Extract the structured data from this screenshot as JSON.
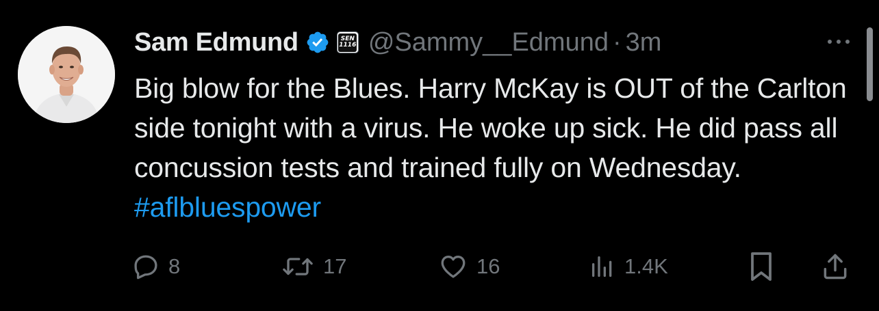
{
  "tweet": {
    "author": {
      "display_name": "Sam Edmund",
      "handle": "@Sammy__Edmund",
      "verified": true,
      "affiliate_badge": {
        "line1": "SEN",
        "line2": "1116"
      }
    },
    "separator": "·",
    "timestamp": "3m",
    "text_main": "Big blow for the Blues. Harry McKay is OUT of the Carlton side tonight with a virus. He woke up sick. He did pass all concussion tests and trained fully on Wednesday.",
    "hashtag": "#aflbluespower",
    "actions": {
      "reply_count": "8",
      "retweet_count": "17",
      "like_count": "16",
      "views_count": "1.4K"
    }
  },
  "colors": {
    "background": "#000000",
    "text": "#e7e9ea",
    "muted": "#71767b",
    "link": "#1d9bf0",
    "verified": "#1d9bf0"
  },
  "icons": {
    "reply": "speech-bubble-icon",
    "retweet": "retweet-arrows-icon",
    "like": "heart-icon",
    "views": "bar-chart-icon",
    "bookmark": "bookmark-icon",
    "share": "share-upload-icon",
    "more": "ellipsis-icon"
  }
}
